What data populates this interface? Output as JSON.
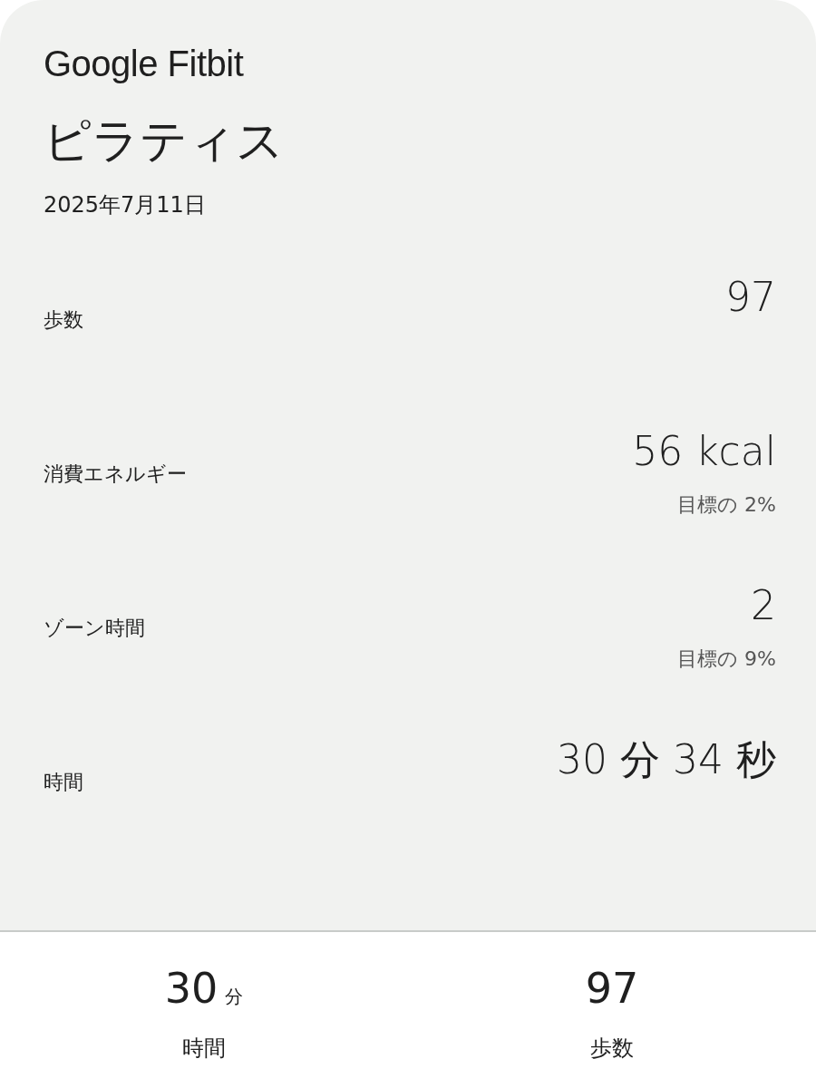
{
  "brand": "Google Fitbit",
  "title": "ピラティス",
  "date": "2025年7月11日",
  "metrics": [
    {
      "label": "歩数",
      "value": "97"
    },
    {
      "label": "消費エネルギー",
      "value": "56 kcal",
      "goal": "目標の 2%"
    },
    {
      "label": "ゾーン時間",
      "value": "2",
      "goal": "目標の 9%"
    },
    {
      "label": "時間",
      "value": "30 分 34 秒"
    }
  ],
  "summary": [
    {
      "value": "30",
      "unit": "分",
      "label": "時間"
    },
    {
      "value": "97",
      "label": "歩数"
    }
  ]
}
